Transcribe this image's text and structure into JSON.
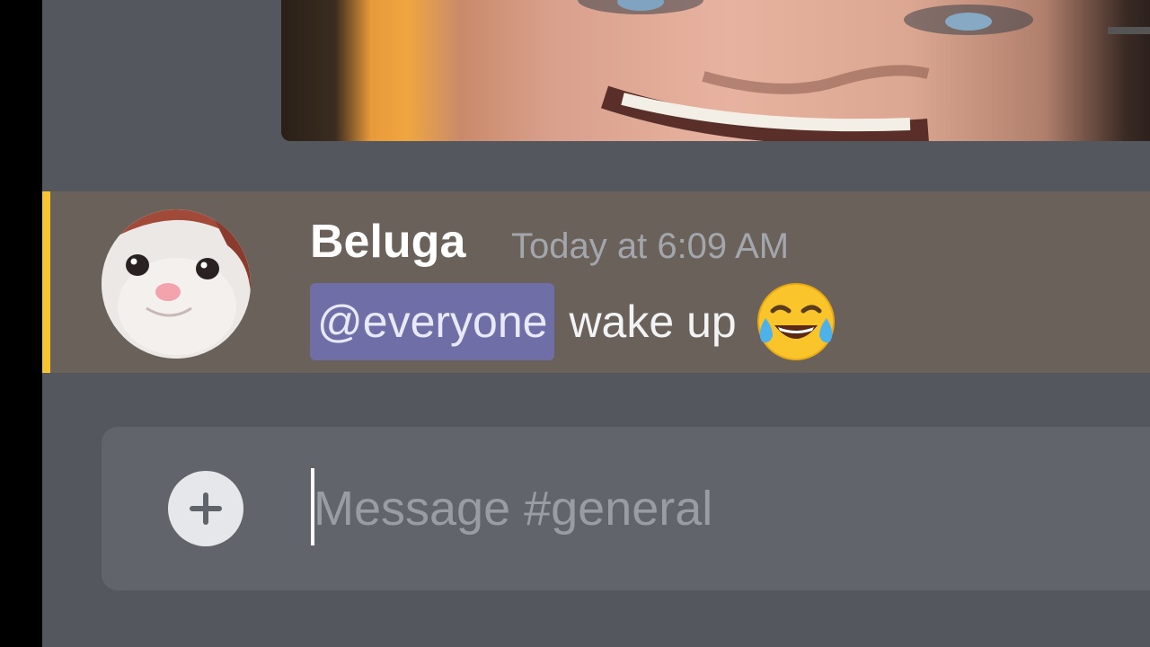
{
  "message": {
    "username": "Beluga",
    "timestamp": "Today at 6:09 AM",
    "mention": "@everyone",
    "text": "wake up",
    "emoji": "face-with-tears-of-joy-icon"
  },
  "composer": {
    "placeholder": "Message #general",
    "value": ""
  },
  "colors": {
    "chat_background": "#54575e",
    "mention_highlight": "#6a615a",
    "mention_bar": "#f7c531",
    "mention_pill": "#6f6ea6",
    "composer_background": "#61646b"
  }
}
